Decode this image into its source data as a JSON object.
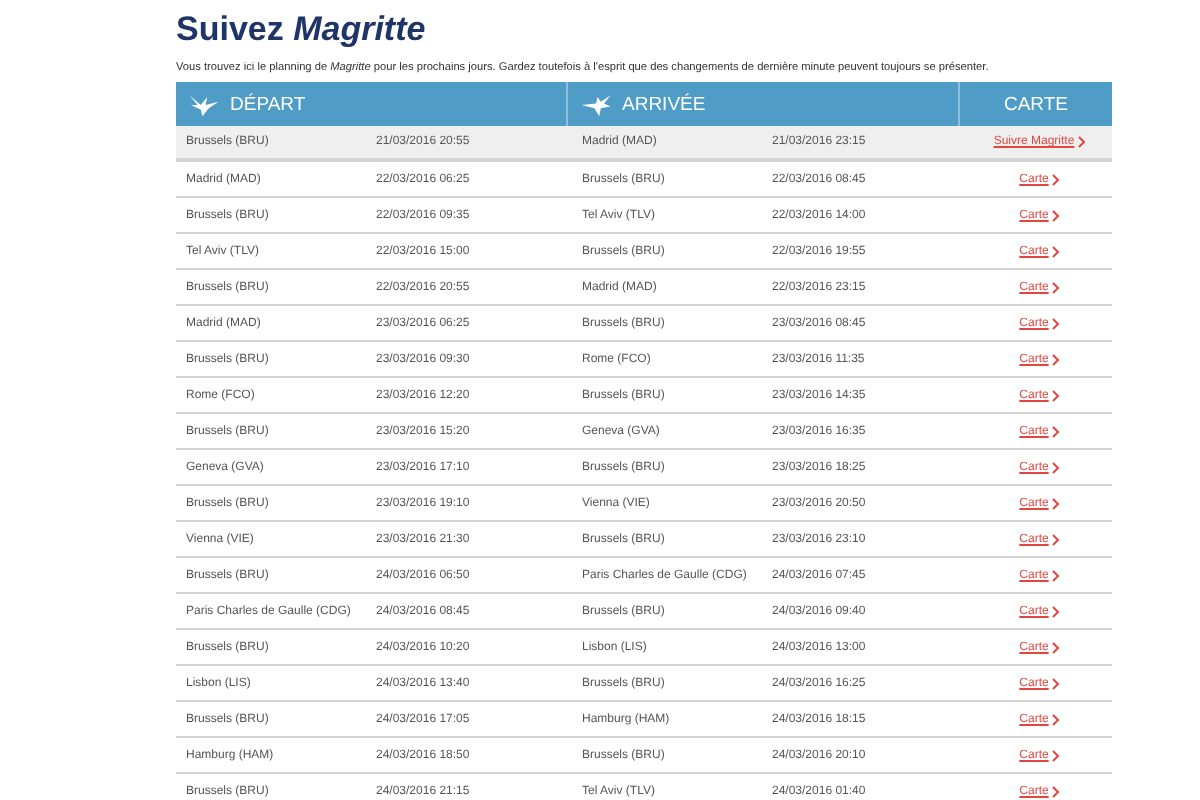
{
  "title": "Suivez *Magritte*",
  "intro": "Vous trouvez ici le planning de *Magritte* pour les prochains jours. Gardez toutefois à l'esprit que des changements de dernière minute peuvent toujours se présenter.",
  "table": {
    "columns": [
      {
        "label": "DÉPART",
        "kind": "departure"
      },
      {
        "label": "ARRIVÉE",
        "kind": "arrival"
      },
      {
        "label": "CARTE",
        "kind": "map"
      }
    ],
    "rows": [
      {
        "from": "Brussels (BRU)",
        "dep": "21/03/2016 20:55",
        "to": "Madrid (MAD)",
        "arr": "21/03/2016 23:15",
        "link": "Suivre Magritte",
        "selected": true
      },
      {
        "from": "Madrid (MAD)",
        "dep": "22/03/2016 06:25",
        "to": "Brussels (BRU)",
        "arr": "22/03/2016 08:45",
        "link": "Carte",
        "selected": false
      },
      {
        "from": "Brussels (BRU)",
        "dep": "22/03/2016 09:35",
        "to": "Tel Aviv (TLV)",
        "arr": "22/03/2016 14:00",
        "link": "Carte",
        "selected": false
      },
      {
        "from": "Tel Aviv (TLV)",
        "dep": "22/03/2016 15:00",
        "to": "Brussels (BRU)",
        "arr": "22/03/2016 19:55",
        "link": "Carte",
        "selected": false
      },
      {
        "from": "Brussels (BRU)",
        "dep": "22/03/2016 20:55",
        "to": "Madrid (MAD)",
        "arr": "22/03/2016 23:15",
        "link": "Carte",
        "selected": false
      },
      {
        "from": "Madrid (MAD)",
        "dep": "23/03/2016 06:25",
        "to": "Brussels (BRU)",
        "arr": "23/03/2016 08:45",
        "link": "Carte",
        "selected": false
      },
      {
        "from": "Brussels (BRU)",
        "dep": "23/03/2016 09:30",
        "to": "Rome (FCO)",
        "arr": "23/03/2016 11:35",
        "link": "Carte",
        "selected": false
      },
      {
        "from": "Rome (FCO)",
        "dep": "23/03/2016 12:20",
        "to": "Brussels (BRU)",
        "arr": "23/03/2016 14:35",
        "link": "Carte",
        "selected": false
      },
      {
        "from": "Brussels (BRU)",
        "dep": "23/03/2016 15:20",
        "to": "Geneva (GVA)",
        "arr": "23/03/2016 16:35",
        "link": "Carte",
        "selected": false
      },
      {
        "from": "Geneva (GVA)",
        "dep": "23/03/2016 17:10",
        "to": "Brussels (BRU)",
        "arr": "23/03/2016 18:25",
        "link": "Carte",
        "selected": false
      },
      {
        "from": "Brussels (BRU)",
        "dep": "23/03/2016 19:10",
        "to": "Vienna (VIE)",
        "arr": "23/03/2016 20:50",
        "link": "Carte",
        "selected": false
      },
      {
        "from": "Vienna (VIE)",
        "dep": "23/03/2016 21:30",
        "to": "Brussels (BRU)",
        "arr": "23/03/2016 23:10",
        "link": "Carte",
        "selected": false
      },
      {
        "from": "Brussels (BRU)",
        "dep": "24/03/2016 06:50",
        "to": "Paris Charles de Gaulle (CDG)",
        "arr": "24/03/2016 07:45",
        "link": "Carte",
        "selected": false
      },
      {
        "from": "Paris Charles de Gaulle (CDG)",
        "dep": "24/03/2016 08:45",
        "to": "Brussels (BRU)",
        "arr": "24/03/2016 09:40",
        "link": "Carte",
        "selected": false
      },
      {
        "from": "Brussels (BRU)",
        "dep": "24/03/2016 10:20",
        "to": "Lisbon (LIS)",
        "arr": "24/03/2016 13:00",
        "link": "Carte",
        "selected": false
      },
      {
        "from": "Lisbon (LIS)",
        "dep": "24/03/2016 13:40",
        "to": "Brussels (BRU)",
        "arr": "24/03/2016 16:25",
        "link": "Carte",
        "selected": false
      },
      {
        "from": "Brussels (BRU)",
        "dep": "24/03/2016 17:05",
        "to": "Hamburg (HAM)",
        "arr": "24/03/2016 18:15",
        "link": "Carte",
        "selected": false
      },
      {
        "from": "Hamburg (HAM)",
        "dep": "24/03/2016 18:50",
        "to": "Brussels (BRU)",
        "arr": "24/03/2016 20:10",
        "link": "Carte",
        "selected": false
      },
      {
        "from": "Brussels (BRU)",
        "dep": "24/03/2016 21:15",
        "to": "Tel Aviv (TLV)",
        "arr": "24/03/2016 01:40",
        "link": "Carte",
        "selected": false
      }
    ]
  }
}
